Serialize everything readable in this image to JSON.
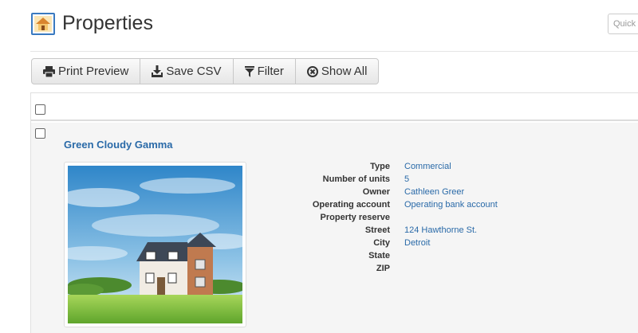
{
  "header": {
    "title": "Properties",
    "quick_search_placeholder": "Quick"
  },
  "toolbar": {
    "print_preview": "Print Preview",
    "save_csv": "Save CSV",
    "filter": "Filter",
    "show_all": "Show All"
  },
  "properties": [
    {
      "name": "Green Cloudy Gamma",
      "details": [
        {
          "label": "Type",
          "value": "Commercial"
        },
        {
          "label": "Number of units",
          "value": "5"
        },
        {
          "label": "Owner",
          "value": "Cathleen Greer"
        },
        {
          "label": "Operating account",
          "value": "Operating bank account"
        },
        {
          "label": "Property reserve",
          "value": ""
        },
        {
          "label": "Street",
          "value": "124 Hawthorne St."
        },
        {
          "label": "City",
          "value": "Detroit"
        },
        {
          "label": "State",
          "value": ""
        },
        {
          "label": "ZIP",
          "value": ""
        }
      ]
    }
  ],
  "colors": {
    "link": "#2a6aa8",
    "row_background": "#f5f5f5",
    "icon_border": "#3a7ac0"
  }
}
